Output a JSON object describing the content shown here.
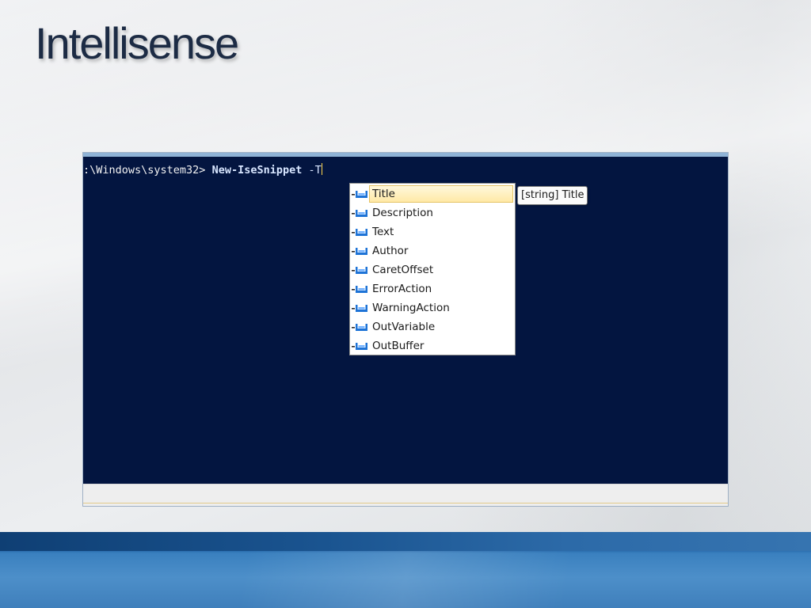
{
  "slide": {
    "title": "Intellisense"
  },
  "console": {
    "prompt": ":\\Windows\\system32> ",
    "command": "New-IseSnippet",
    "space": " ",
    "param_prefix": "-T"
  },
  "completion": {
    "items": [
      {
        "label": "Title",
        "selected": true
      },
      {
        "label": "Description",
        "selected": false
      },
      {
        "label": "Text",
        "selected": false
      },
      {
        "label": "Author",
        "selected": false
      },
      {
        "label": "CaretOffset",
        "selected": false
      },
      {
        "label": "ErrorAction",
        "selected": false
      },
      {
        "label": "WarningAction",
        "selected": false
      },
      {
        "label": "OutVariable",
        "selected": false
      },
      {
        "label": "OutBuffer",
        "selected": false
      }
    ],
    "icon": "parameter-icon"
  },
  "tooltip": {
    "text": "[string] Title"
  },
  "colors": {
    "console_bg": "#031540",
    "selection_bg": "#ffe9a6",
    "icon_blue": "#1e73d6",
    "footer_blue": "#2b6fb0"
  }
}
